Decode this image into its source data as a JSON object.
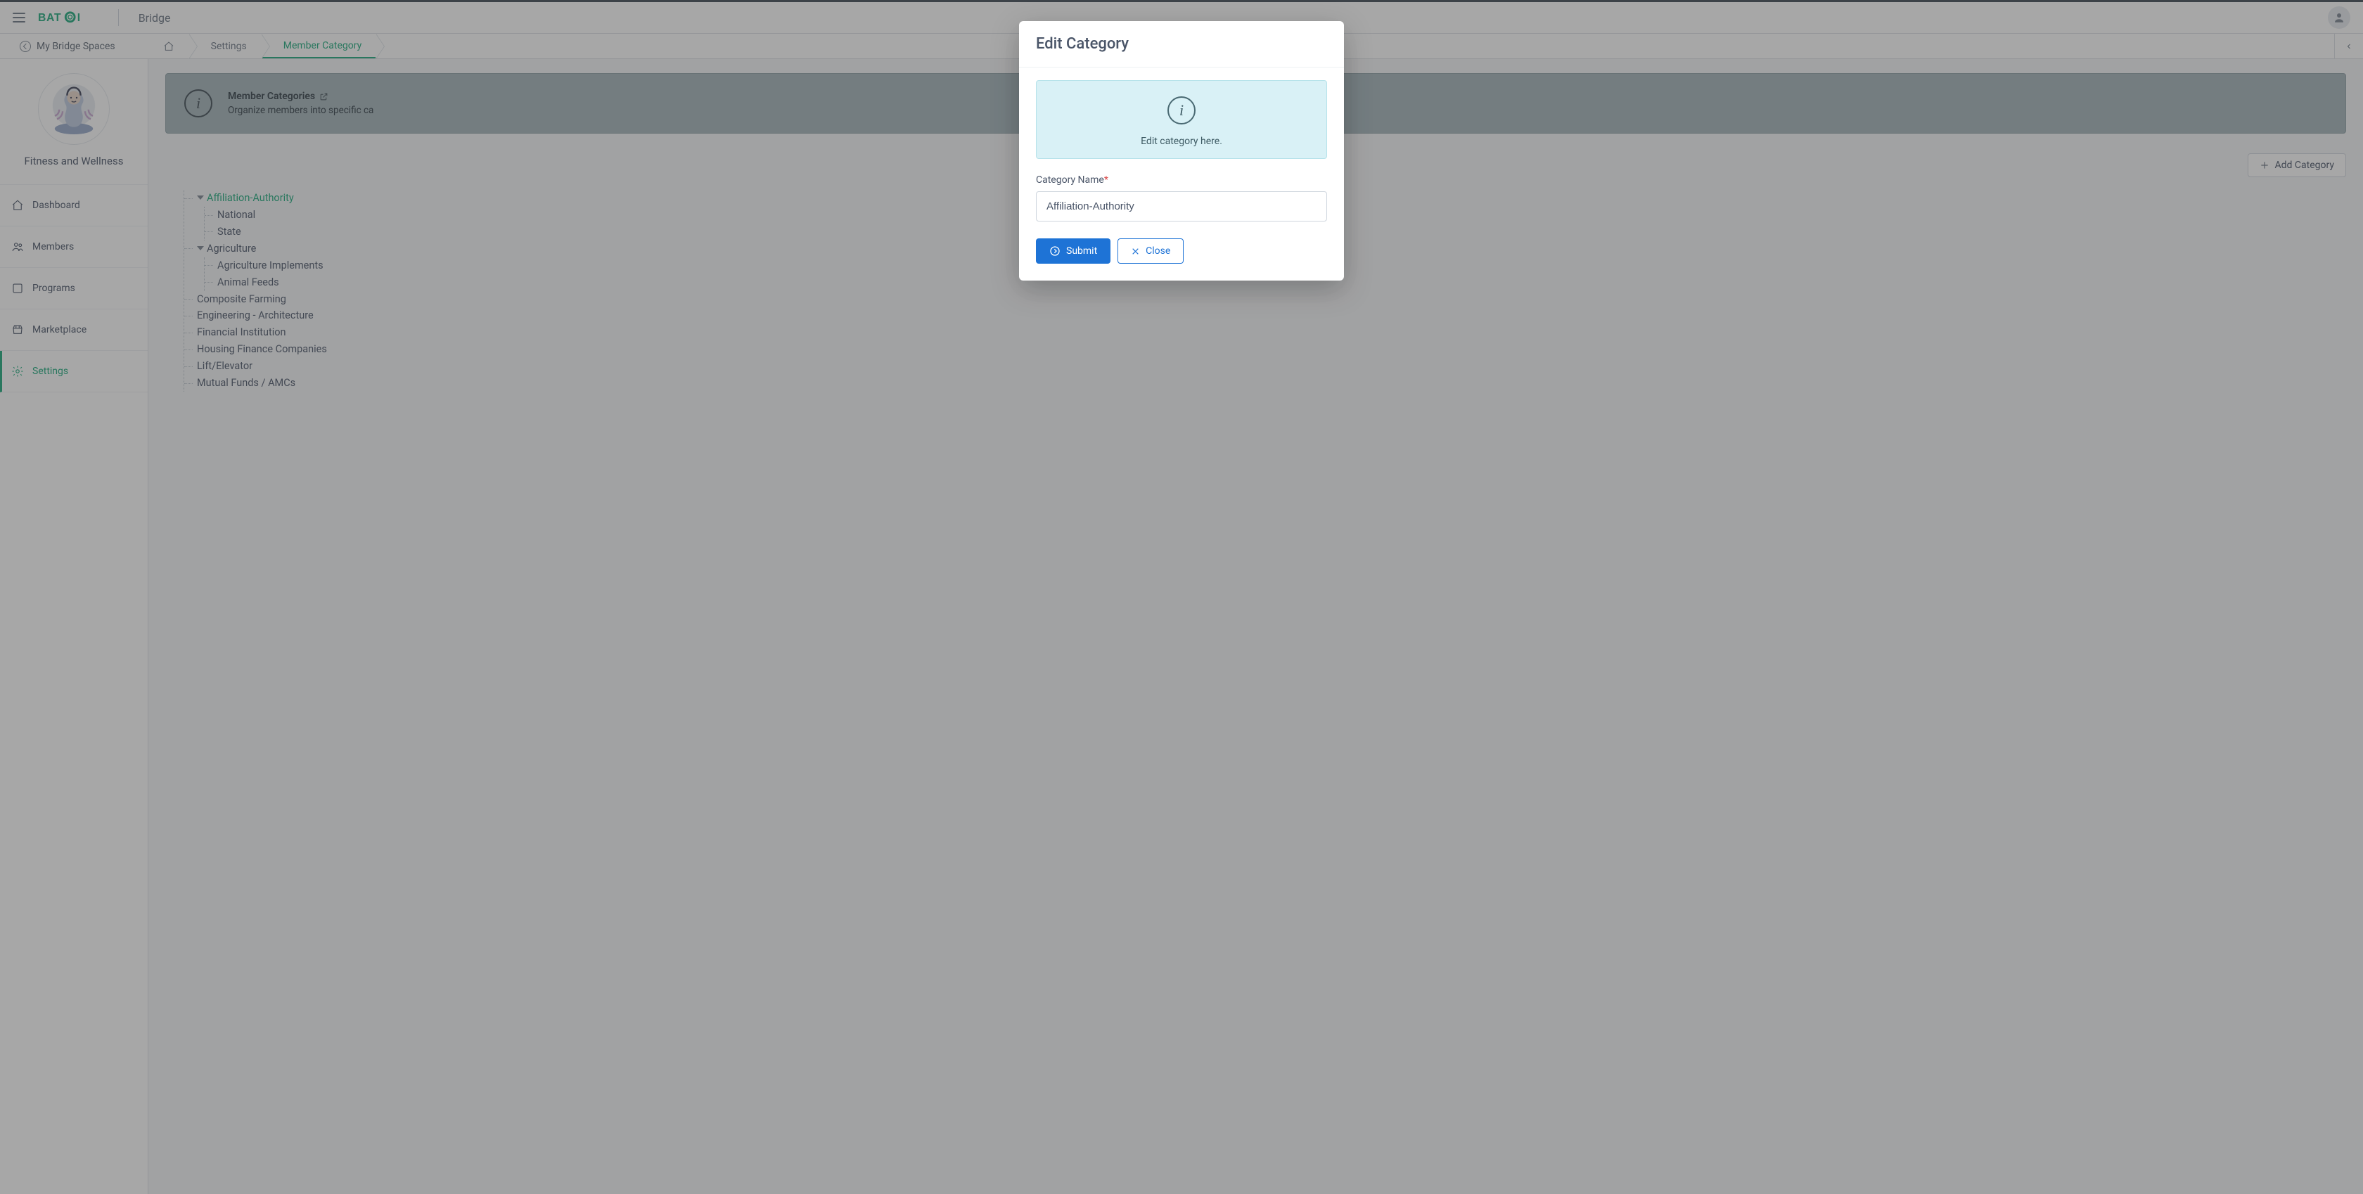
{
  "topbar": {
    "product_name": "Bridge"
  },
  "subbar": {
    "back_label": "My Bridge Spaces",
    "crumbs": {
      "settings": "Settings",
      "member_category": "Member Category"
    }
  },
  "space": {
    "name": "Fitness and Wellness"
  },
  "nav": {
    "dashboard": "Dashboard",
    "members": "Members",
    "programs": "Programs",
    "marketplace": "Marketplace",
    "settings": "Settings"
  },
  "banner": {
    "title": "Member Categories",
    "desc": "Organize members into specific ca"
  },
  "toolbar": {
    "add_label": "Add Category"
  },
  "tree": {
    "n0": "Affiliation-Authority",
    "n0_0": "National",
    "n0_1": "State",
    "n1": "Agriculture",
    "n1_0": "Agriculture Implements",
    "n1_1": "Animal Feeds",
    "n2": "Composite Farming",
    "n3": "Engineering - Architecture",
    "n4": "Financial Institution",
    "n5": "Housing Finance Companies",
    "n6": "Lift/Elevator",
    "n7": "Mutual Funds / AMCs"
  },
  "modal": {
    "title": "Edit Category",
    "info_msg": "Edit category here.",
    "field_label": "Category Name",
    "required_mark": "*",
    "input_value": "Affiliation-Authority",
    "submit_label": "Submit",
    "close_label": "Close"
  }
}
